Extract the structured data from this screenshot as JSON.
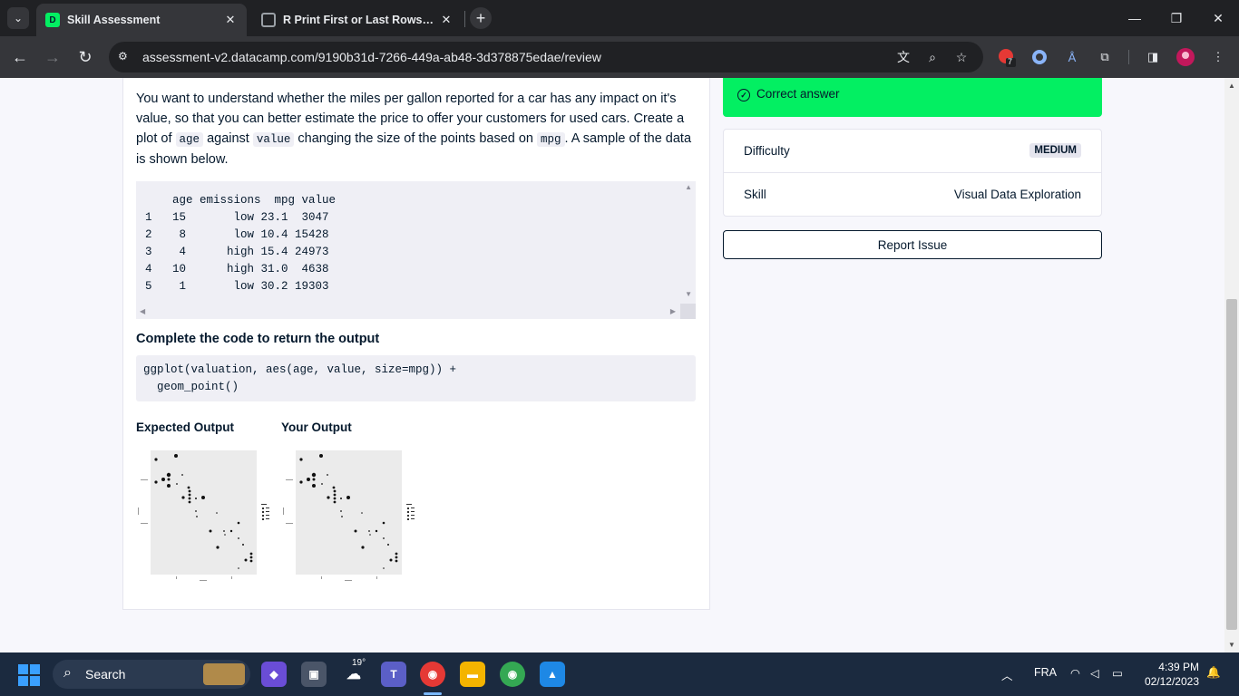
{
  "browser": {
    "tabs": [
      {
        "title": "Skill Assessment",
        "active": true
      },
      {
        "title": "R Print First or Last Rows of Da",
        "active": false
      }
    ],
    "url": "assessment-v2.datacamp.com/9190b31d-7266-449a-ab48-3d378875edae/review",
    "extension_badge": "7"
  },
  "question": {
    "text_1": "You want to understand whether the miles per gallon reported for a car has any impact on it's value, so that you can better estimate the price to offer your customers for used cars. Create a plot of",
    "code_age": "age",
    "text_2": "against",
    "code_value": "value",
    "text_3": "changing the size of the points based on",
    "code_mpg": "mpg",
    "text_4": ". A sample of the data is shown below."
  },
  "data_table": {
    "header": "    age emissions  mpg value",
    "rows": [
      "1   15       low 23.1  3047",
      "2    8       low 10.4 15428",
      "3    4      high 15.4 24973",
      "4   10      high 31.0  4638",
      "5    1       low 30.2 19303"
    ]
  },
  "task": {
    "title": "Complete the code to return the output",
    "code_line_1": "ggplot(valuation, aes(age, value, size=mpg)) +",
    "code_line_2": "  geom_point()"
  },
  "outputs": {
    "expected_label": "Expected Output",
    "yours_label": "Your Output"
  },
  "result": {
    "status": "Correct answer",
    "difficulty_label": "Difficulty",
    "difficulty": "MEDIUM",
    "skill_label": "Skill",
    "skill": "Visual Data Exploration",
    "report_button": "Report Issue"
  },
  "taskbar": {
    "search_placeholder": "Search",
    "weather": "19°",
    "language": "FRA",
    "time": "4:39 PM",
    "date": "02/12/2023",
    "colors": {
      "accent": "#03ef62",
      "navy": "#05192d"
    }
  }
}
